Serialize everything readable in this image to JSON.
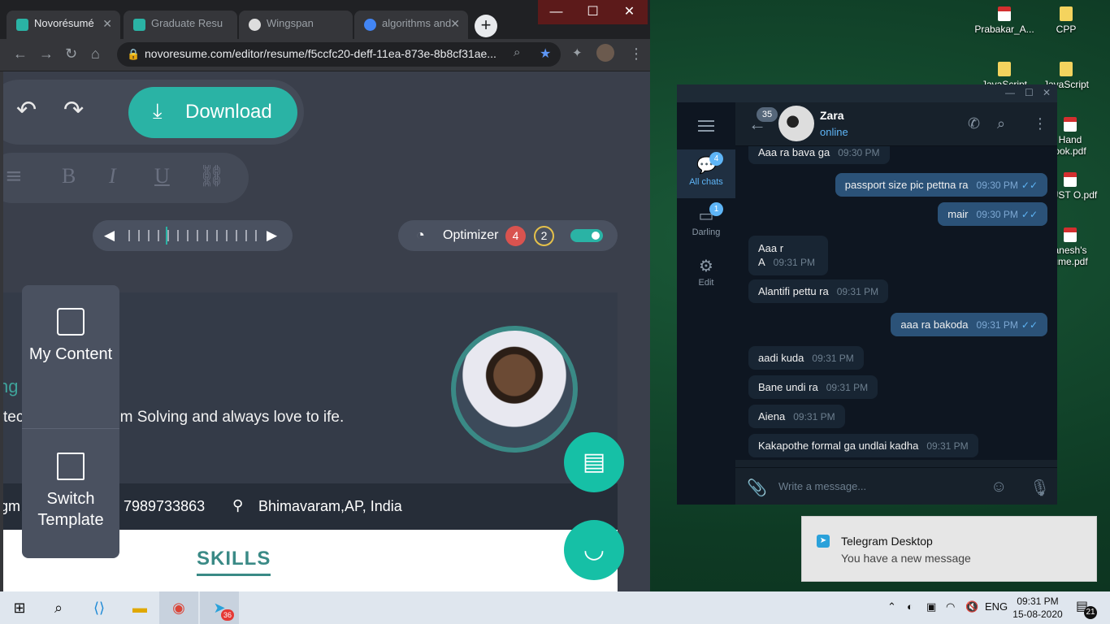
{
  "desktop": {
    "icons": [
      {
        "label": "Prabakar_A...",
        "type": "pdf"
      },
      {
        "label": "CPP",
        "type": "folder"
      },
      {
        "label": "JavaScript",
        "type": "folder"
      },
      {
        "label": "JavaScript",
        "type": "folder"
      },
      {
        "label": "Hand ook.pdf",
        "type": "pdf"
      },
      {
        "label": "MUST O.pdf",
        "type": "pdf"
      },
      {
        "label": "anesh's ume.pdf",
        "type": "pdf"
      }
    ]
  },
  "browser": {
    "tabs": [
      {
        "label": "Novorésumé",
        "favicon_color": "#2ab3a5"
      },
      {
        "label": "Graduate Resu",
        "favicon_color": "#2ab3a5"
      },
      {
        "label": "Wingspan",
        "favicon_color": "#dddddd"
      },
      {
        "label": "algorithms and",
        "favicon_color": "#4285f4"
      }
    ],
    "new_tab": "+",
    "url": "novoresume.com/editor/resume/f5ccfc20-deff-11ea-873e-8b8cf31ae...",
    "window_controls": {
      "minimize": "—",
      "maximize": "☐",
      "close": "✕"
    }
  },
  "editor": {
    "download_label": "Download",
    "optimizer_label": "Optimizer",
    "optimizer_errors": "4",
    "optimizer_warnings": "2",
    "side_menu": {
      "my_content": "My Content",
      "switch_template": "Switch Template"
    },
    "resume": {
      "name_fragment": "ng",
      "summary": "technical , problem Solving and always love to ife.",
      "email_fragment": "gm",
      "phone": "7989733863",
      "location": "Bhimavaram,AP, India",
      "skills_heading": "SKILLS"
    }
  },
  "telegram": {
    "folders": [
      {
        "label": "All chats",
        "badge": "4"
      },
      {
        "label": "Darling",
        "badge": "1"
      },
      {
        "label": "Edit",
        "badge": ""
      }
    ],
    "unread": "35",
    "contact_name": "Zara",
    "contact_status": "online",
    "messages": [
      {
        "text": "Aaa ra bava ga",
        "time": "09:30 PM",
        "dir": "in"
      },
      {
        "text": "passport size pic pettna ra",
        "time": "09:30 PM",
        "dir": "out"
      },
      {
        "text": "mair",
        "time": "09:30 PM",
        "dir": "out"
      },
      {
        "text": "Aaa r A",
        "time": "09:31 PM",
        "dir": "in"
      },
      {
        "text": "Alantifi pettu ra",
        "time": "09:31 PM",
        "dir": "in"
      },
      {
        "text": "aaa ra bakoda",
        "time": "09:31 PM",
        "dir": "out"
      },
      {
        "text": "aadi kuda",
        "time": "09:31 PM",
        "dir": "in"
      },
      {
        "text": "Bane undi ra",
        "time": "09:31 PM",
        "dir": "in"
      },
      {
        "text": "Aiena",
        "time": "09:31 PM",
        "dir": "in"
      },
      {
        "text": "Kakapothe formal ga undlai kadha",
        "time": "09:31 PM",
        "dir": "in"
      }
    ],
    "input_placeholder": "Write a message..."
  },
  "notification": {
    "title": "Telegram Desktop",
    "message": "You have a new message"
  },
  "taskbar": {
    "telegram_badge": "36",
    "language": "ENG",
    "time": "09:31 PM",
    "date": "15-08-2020",
    "notification_count": "21"
  }
}
